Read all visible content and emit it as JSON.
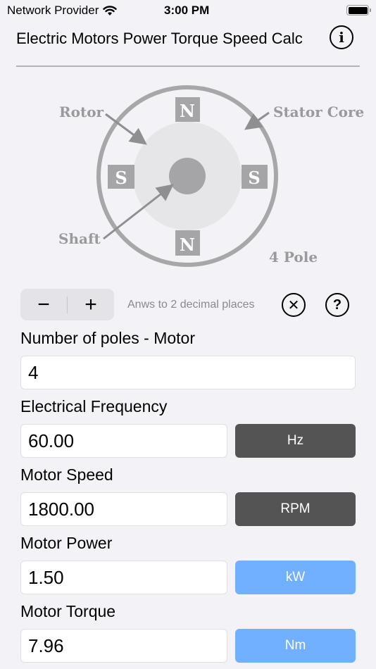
{
  "status_bar": {
    "carrier": "Network Provider",
    "time": "3:00 PM",
    "wifi_icon": "wifi-icon",
    "battery_icon": "battery-full-icon"
  },
  "nav": {
    "title": "Electric Motors Power Torque Speed Calc",
    "info_icon": "i"
  },
  "diagram": {
    "labels": {
      "rotor": "Rotor",
      "stator": "Stator Core",
      "shaft": "Shaft",
      "poles": "4 Pole"
    },
    "pole_marks": {
      "top": "N",
      "bottom": "N",
      "left": "S",
      "right": "S"
    },
    "colors": {
      "ring": "#a7a7aa",
      "rotor": "#e6e6e8",
      "shaft": "#a5a5a8",
      "label": "#9a9a9d"
    }
  },
  "controls": {
    "stepper_minus": "−",
    "stepper_plus": "+",
    "decimal_label": "Anws to 2 decimal places",
    "clear_icon": "✕",
    "help_icon": "?"
  },
  "fields": [
    {
      "label": "Number of poles - Motor",
      "value": "4"
    },
    {
      "label": "Electrical Frequency",
      "value": "60.00",
      "unit": "Hz",
      "unit_color": "#545454"
    },
    {
      "label": "Motor Speed",
      "value": "1800.00",
      "unit": "RPM",
      "unit_color": "#545454"
    },
    {
      "label": "Motor Power",
      "value": "1.50",
      "unit": "kW",
      "unit_color": "#70b0ff"
    },
    {
      "label": "Motor Torque",
      "value": "7.96",
      "unit": "Nm",
      "unit_color": "#70b0ff"
    }
  ]
}
